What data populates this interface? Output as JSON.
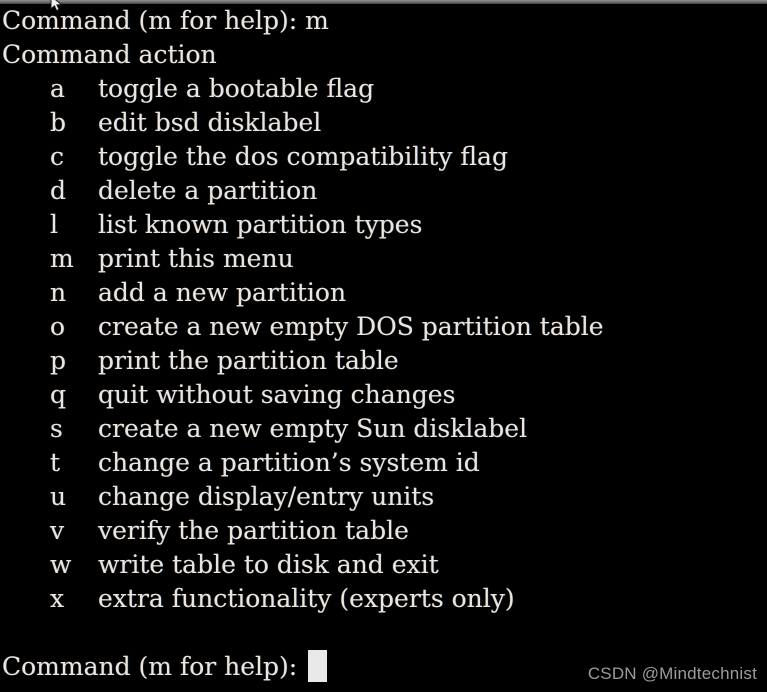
{
  "window": {
    "title_bar_present": true,
    "background_color": "#000000",
    "foreground_color": "#e8e6e2",
    "top_bar_color": "#6e6e6e"
  },
  "pointer": {
    "icon": "mouse-arrow-cursor"
  },
  "terminal": {
    "header_lines": [
      "Command (m for help): m",
      "Command action"
    ],
    "menu_items": [
      {
        "key": "a",
        "description": "toggle a bootable flag"
      },
      {
        "key": "b",
        "description": "edit bsd disklabel"
      },
      {
        "key": "c",
        "description": "toggle the dos compatibility flag"
      },
      {
        "key": "d",
        "description": "delete a partition"
      },
      {
        "key": "l",
        "description": "list known partition types"
      },
      {
        "key": "m",
        "description": "print this menu"
      },
      {
        "key": "n",
        "description": "add a new partition"
      },
      {
        "key": "o",
        "description": "create a new empty DOS partition table"
      },
      {
        "key": "p",
        "description": "print the partition table"
      },
      {
        "key": "q",
        "description": "quit without saving changes"
      },
      {
        "key": "s",
        "description": "create a new empty Sun disklabel"
      },
      {
        "key": "t",
        "description": "change a partition’s system id"
      },
      {
        "key": "u",
        "description": "change display/entry units"
      },
      {
        "key": "v",
        "description": "verify the partition table"
      },
      {
        "key": "w",
        "description": "write table to disk and exit"
      },
      {
        "key": "x",
        "description": "extra functionality (experts only)"
      }
    ],
    "blank_line": " ",
    "prompt": {
      "text": "Command (m for help): ",
      "cursor": "block-cursor",
      "cursor_color": "#e9e9e9"
    }
  },
  "watermark": {
    "text": "CSDN @Mindtechnist",
    "color": "#9b9b9b"
  }
}
